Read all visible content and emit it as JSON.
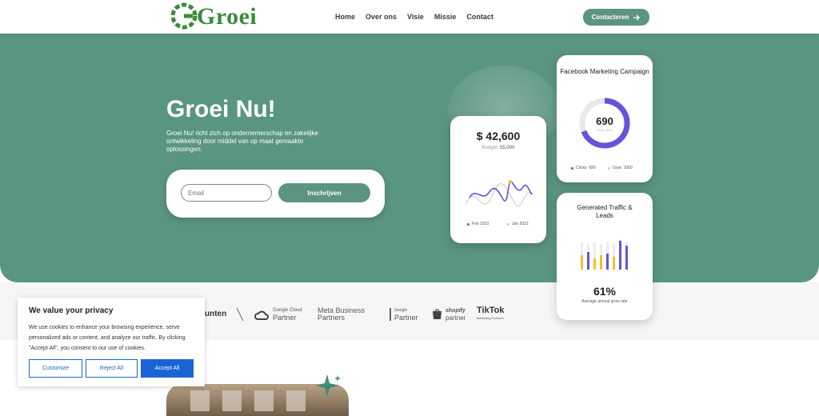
{
  "header": {
    "logo_text": "Groei",
    "nav": [
      "Home",
      "Over ons",
      "Visie",
      "Missie",
      "Contact"
    ],
    "cta_label": "Contacteren",
    "cta_icon": "arrow-right-icon"
  },
  "hero": {
    "title": "Groei Nu!",
    "description": "Groei Nu! richt zich op ondernemerschap en zakelijke ontwikkeling door middel van op maat gemaakte oplossingen.",
    "email_placeholder": "Email",
    "submit_label": "Inschrijven",
    "background_color": "#5a9580"
  },
  "budget_card": {
    "amount": "$ 42,600",
    "budget_label": "Budget:",
    "budget_value": "55,000",
    "legend": [
      "Feb 2023",
      "Jan 2023"
    ]
  },
  "facebook_card": {
    "title": "Facebook Marketing Campaign",
    "value": "690",
    "goal_caption": "Goal: 1000",
    "legend_clicks_label": "Clicks",
    "legend_clicks_value": "690",
    "legend_goal_label": "Goal",
    "legend_goal_value": "1000",
    "progress": 0.69
  },
  "traffic_card": {
    "title": "Generated Traffic & Leads",
    "percentage": "61%",
    "caption": "Average annual grow rate"
  },
  "partners": {
    "partial_text": "unten",
    "google_cloud_top": "Google Cloud",
    "google_cloud_bottom": "Partner",
    "meta_top": "Meta Business",
    "meta_bottom": "Partners",
    "google_top": "Google",
    "google_bottom": "Partner",
    "shopify_top": "shopify",
    "shopify_bottom": "partner",
    "tiktok_top": "TikTok",
    "tiktok_bottom": "Marketing Partners"
  },
  "cookie": {
    "title": "We value your privacy",
    "text": "We use cookies to enhance your browsing experience, serve personalized ads or content, and analyze our traffic. By clicking \"Accept All\", you consent to our use of cookies.",
    "customize": "Customize",
    "reject": "Reject All",
    "accept": "Accept All"
  },
  "colors": {
    "accent": "#5c9480",
    "chart_purple": "#6a52d8",
    "chart_yellow": "#f2c12e",
    "cookie_blue": "#1a63d6"
  }
}
